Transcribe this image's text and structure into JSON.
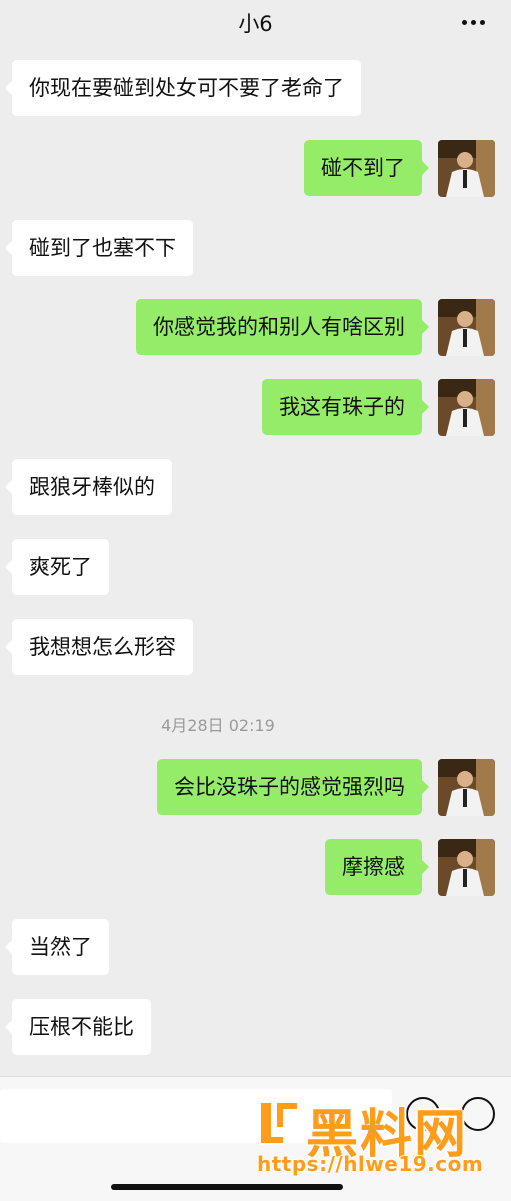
{
  "header": {
    "title": "小6"
  },
  "messages": [
    {
      "side": "in",
      "text": "你现在要碰到处女可不要了老命了"
    },
    {
      "side": "out",
      "text": "碰不到了"
    },
    {
      "side": "in",
      "text": "碰到了也塞不下"
    },
    {
      "side": "out",
      "text": "你感觉我的和别人有啥区别"
    },
    {
      "side": "out",
      "text": "我这有珠子的"
    },
    {
      "side": "in",
      "text": "跟狼牙棒似的"
    },
    {
      "side": "in",
      "text": "爽死了"
    },
    {
      "side": "in",
      "text": "我想想怎么形容"
    },
    {
      "side": "out",
      "text": "会比没珠子的感觉强烈吗"
    },
    {
      "side": "out",
      "text": "摩擦感"
    },
    {
      "side": "in",
      "text": "当然了"
    },
    {
      "side": "in",
      "text": "压根不能比"
    }
  ],
  "timestamp": "4月28日 02:19",
  "watermark": {
    "name": "黑料网",
    "url": "https://hlwe19.com"
  },
  "colors": {
    "background": "#ededed",
    "outgoing_bubble": "#95ec69",
    "incoming_bubble": "#ffffff",
    "watermark": "#ff9c1a"
  },
  "icons": {
    "more": "more-dots-icon",
    "avatar": "user-avatar"
  }
}
